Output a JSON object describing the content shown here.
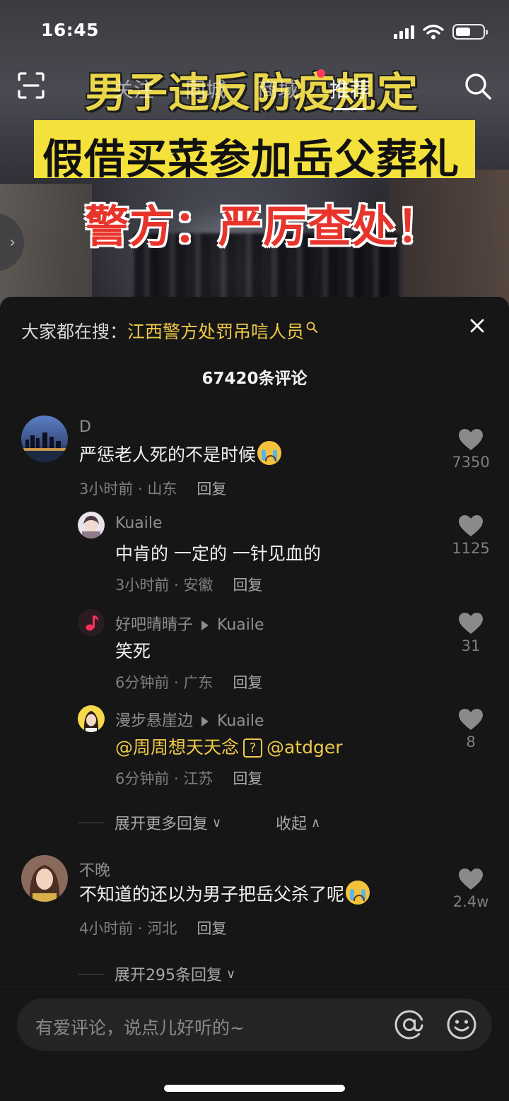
{
  "status_bar": {
    "time": "16:45"
  },
  "top_nav": {
    "tabs": [
      "关注",
      "同城",
      "商城",
      "推荐"
    ],
    "active_tab": "推荐",
    "icons": {
      "left": "scan-icon",
      "right": "search-icon"
    }
  },
  "video": {
    "headline_1": "男子违反防疫规定",
    "headline_2": "假借买菜参加岳父葬礼",
    "headline_3": "警方：严厉查处！",
    "colors": {
      "headline_yellow": "#f7e34a",
      "headline_red": "#e8352c"
    }
  },
  "comments_panel": {
    "hot_search_label": "大家都在搜：",
    "hot_search_term": "江西警方处罚吊唁人员",
    "comment_count": "67420条评论",
    "comments": [
      {
        "user": "D",
        "text": "严惩老人死的不是时候",
        "time_location": "3小时前 · 山东",
        "reply_label": "回复",
        "likes": "7350",
        "replies": [
          {
            "user": "Kuaile",
            "text": "中肯的 一定的 一针见血的",
            "time_location": "3小时前 · 安徽",
            "reply_label": "回复",
            "likes": "1125"
          },
          {
            "user": "好吧晴晴子",
            "reply_to": "Kuaile",
            "text": "笑死",
            "time_location": "6分钟前 · 广东",
            "reply_label": "回复",
            "likes": "31"
          },
          {
            "user": "漫步悬崖边",
            "reply_to": "Kuaile",
            "mention_1": "@周周想天天念",
            "qbox": "?",
            "mention_2": "@atdger",
            "time_location": "6分钟前 · 江苏",
            "reply_label": "回复",
            "likes": "8"
          }
        ],
        "expand_more": "展开更多回复",
        "collapse": "收起"
      },
      {
        "user": "不晚",
        "text": "不知道的还以为男子把岳父杀了呢",
        "time_location": "4小时前 · 河北",
        "reply_label": "回复",
        "likes": "2.4w",
        "expand_replies": "展开295条回复"
      }
    ]
  },
  "input_bar": {
    "placeholder": "有爱评论，说点儿好听的~"
  },
  "accent_colors": {
    "highlight": "#f0c94a",
    "notification_dot": "#ff3b5c"
  }
}
